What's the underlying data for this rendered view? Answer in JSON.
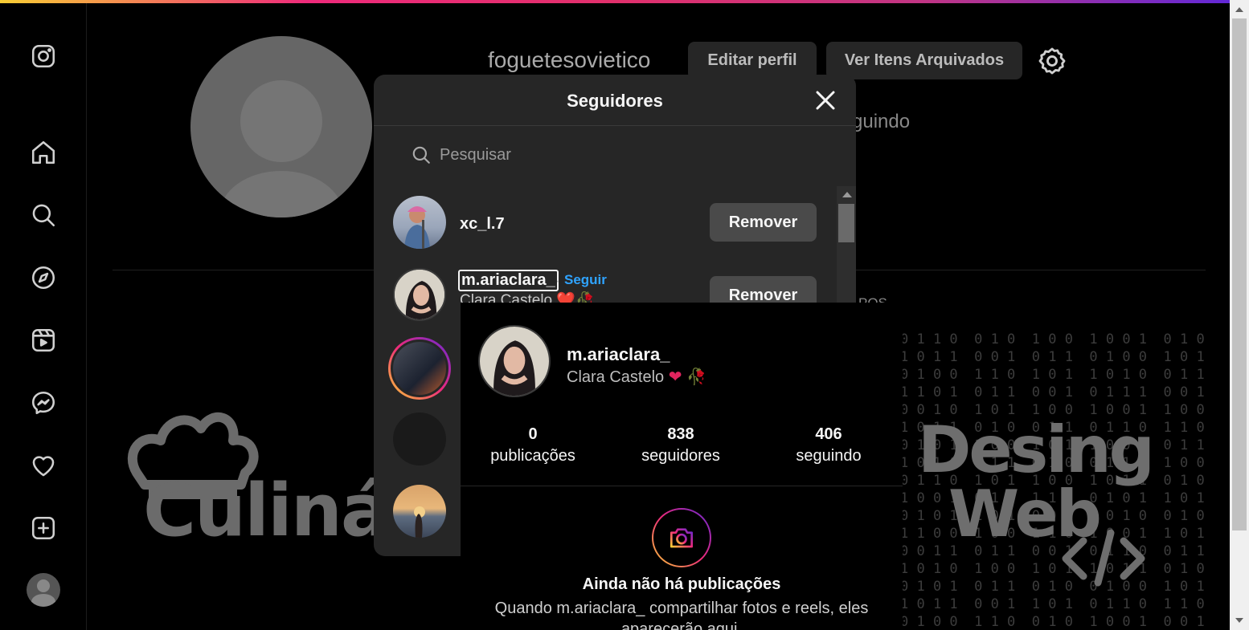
{
  "profile": {
    "username": "foguetesovietico",
    "edit_button": "Editar perfil",
    "archive_button": "Ver Itens Arquivados",
    "bg_following_fragment": "guindo",
    "bg_posts_fragment": "POS"
  },
  "background": {
    "culinaria_text": "Culinár",
    "desing_text": "Desing",
    "web_text": "Web"
  },
  "modal": {
    "title": "Seguidores",
    "search_placeholder": "Pesquisar",
    "followers": [
      {
        "username": "xc_l.7",
        "subtitle": "",
        "follow": "",
        "button": "Remover"
      },
      {
        "username": "m.ariaclara_",
        "subtitle": "Clara Castelo ❤️🥀",
        "follow": "Seguir",
        "button": "Remover"
      }
    ]
  },
  "hovercard": {
    "username": "m.ariaclara_",
    "display_name": "Clara Castelo",
    "stats": [
      {
        "value": "0",
        "label": "publicações"
      },
      {
        "value": "838",
        "label": "seguidores"
      },
      {
        "value": "406",
        "label": "seguindo"
      }
    ],
    "empty_title": "Ainda não há publicações",
    "empty_text": "Quando m.ariaclara_ compartilhar fotos e reels, eles aparecerão aqui."
  },
  "colors": {
    "accent_link": "#2fa3ff",
    "heart": "#e0245e"
  }
}
